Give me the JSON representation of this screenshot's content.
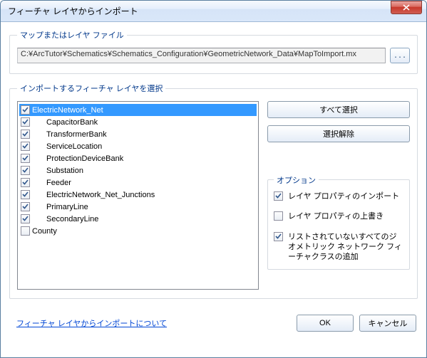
{
  "title": "フィーチャ レイヤからインポート",
  "file_section": {
    "legend": "マップまたはレイヤ ファイル",
    "path": "C:¥ArcTutor¥Schematics¥Schematics_Configuration¥GeometricNetwork_Data¥MapToImport.mx",
    "browse_label": "..."
  },
  "layers_section": {
    "legend": "インポートするフィーチャ レイヤを選択",
    "items": [
      {
        "label": "ElectricNetwork_Net",
        "checked": true,
        "indent": 0,
        "selected": true
      },
      {
        "label": "CapacitorBank",
        "checked": true,
        "indent": 1,
        "selected": false
      },
      {
        "label": "TransformerBank",
        "checked": true,
        "indent": 1,
        "selected": false
      },
      {
        "label": "ServiceLocation",
        "checked": true,
        "indent": 1,
        "selected": false
      },
      {
        "label": "ProtectionDeviceBank",
        "checked": true,
        "indent": 1,
        "selected": false
      },
      {
        "label": "Substation",
        "checked": true,
        "indent": 1,
        "selected": false
      },
      {
        "label": "Feeder",
        "checked": true,
        "indent": 1,
        "selected": false
      },
      {
        "label": "ElectricNetwork_Net_Junctions",
        "checked": true,
        "indent": 1,
        "selected": false
      },
      {
        "label": "PrimaryLine",
        "checked": true,
        "indent": 1,
        "selected": false
      },
      {
        "label": "SecondaryLine",
        "checked": true,
        "indent": 1,
        "selected": false
      },
      {
        "label": "County",
        "checked": false,
        "indent": 0,
        "selected": false
      }
    ],
    "select_all_label": "すべて選択",
    "clear_all_label": "選択解除"
  },
  "options": {
    "legend": "オプション",
    "import_props": {
      "label": "レイヤ プロパティのインポート",
      "checked": true
    },
    "override_props": {
      "label": "レイヤ プロパティの上書き",
      "checked": false
    },
    "add_unlisted": {
      "label": "リストされていないすべてのジオメトリック ネットワーク フィーチャクラスの追加",
      "checked": true
    }
  },
  "footer": {
    "help_link": "フィーチャ レイヤからインポートについて",
    "ok": "OK",
    "cancel": "キャンセル"
  }
}
